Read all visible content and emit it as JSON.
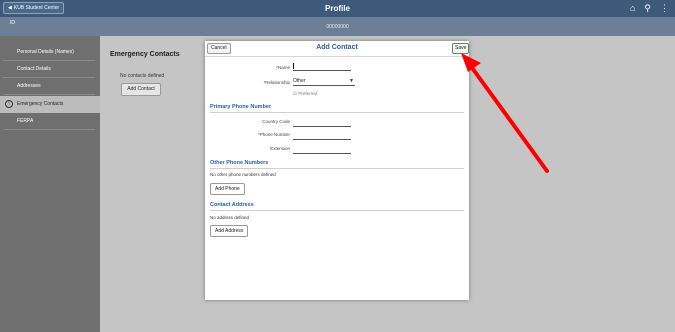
{
  "header": {
    "back_label": "KUB Student Center",
    "title": "Profile"
  },
  "subheader": {
    "left_text": "ID",
    "id_text": "00000000"
  },
  "sidebar": {
    "items": [
      {
        "label": "Personal Details (Names)"
      },
      {
        "label": "Contact Details"
      },
      {
        "label": "Addresses"
      },
      {
        "label": "Emergency Contacts"
      },
      {
        "label": "FERPA"
      }
    ]
  },
  "main": {
    "title": "Emergency Contacts",
    "empty_text": "No contacts defined",
    "add_button": "Add Contact"
  },
  "modal": {
    "cancel_label": "Cancel",
    "title": "Add Contact",
    "save_label": "Save",
    "name_label": "*Name",
    "relationship_label": "*Relationship",
    "relationship_value": "Other",
    "preferred_label": "Preferred",
    "primary_phone_title": "Primary Phone Number",
    "country_code_label": "Country Code",
    "phone_number_label": "*Phone Number",
    "extension_label": "Extension",
    "other_phones_title": "Other Phone Numbers",
    "other_phones_empty": "No other phone numbers defined",
    "add_phone_label": "Add Phone",
    "address_title": "Contact Address",
    "address_empty": "No address defined",
    "add_address_label": "Add Address"
  },
  "colors": {
    "topbar": "#3d5a7a",
    "subbar": "#6c7f96",
    "accent_blue": "#2a5ea3",
    "annotation_arrow": "#ff0000"
  }
}
